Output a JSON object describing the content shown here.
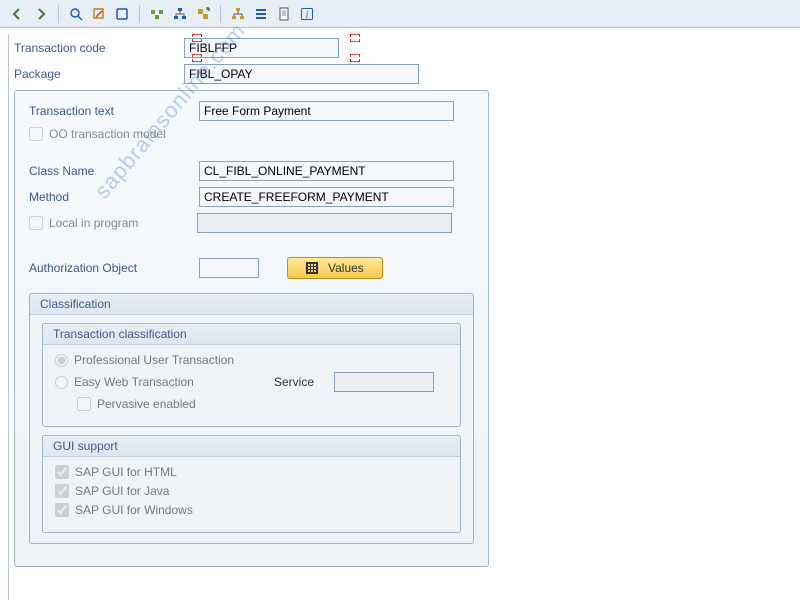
{
  "toolbar": {
    "back": "⇦",
    "forward": "⇨"
  },
  "fields": {
    "tcode_label": "Transaction code",
    "tcode_value": "FIBLFFP",
    "package_label": "Package",
    "package_value": "FIBL_OPAY",
    "text_label": "Transaction text",
    "text_value": "Free Form Payment",
    "oo_label": "OO transaction model",
    "class_label": "Class Name",
    "class_value": "CL_FIBL_ONLINE_PAYMENT",
    "method_label": "Method",
    "method_value": "CREATE_FREEFORM_PAYMENT",
    "local_label": "Local in program",
    "auth_label": "Authorization Object",
    "values_btn": "Values"
  },
  "classification": {
    "title": "Classification",
    "trans_title": "Transaction classification",
    "radio_prof": "Professional User Transaction",
    "radio_easy": "Easy Web Transaction",
    "service_label": "Service",
    "pervasive": "Pervasive enabled",
    "gui_title": "GUI support",
    "gui_html": "SAP GUI for HTML",
    "gui_java": "SAP GUI for Java",
    "gui_win": "SAP GUI for Windows"
  },
  "watermark": "sapbrainsonline.com"
}
